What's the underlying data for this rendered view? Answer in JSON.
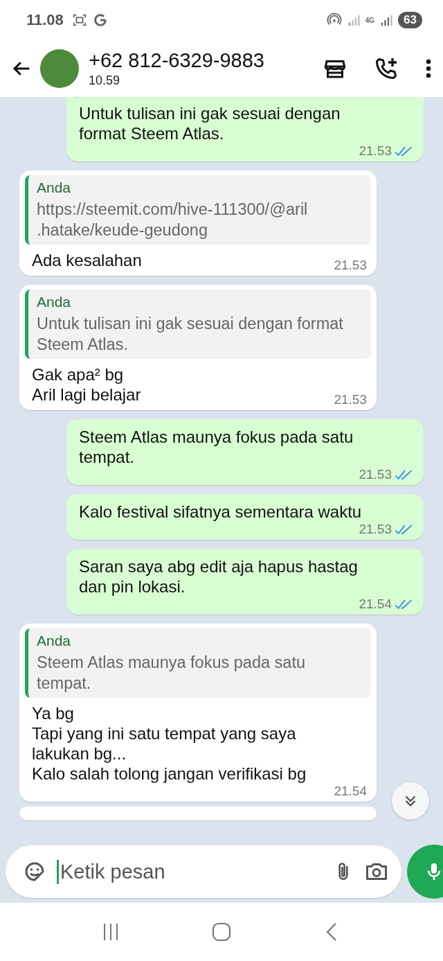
{
  "status_bar": {
    "time": "11.08",
    "network": "4G",
    "battery": "63"
  },
  "header": {
    "contact": "+62 812-6329-9883",
    "last_seen": "10.59"
  },
  "messages": [
    {
      "kind": "out",
      "quote_cut": true,
      "text": "Untuk tulisan ini gak sesuai dengan format Steem Atlas.",
      "time": "21.53",
      "read": true
    },
    {
      "kind": "in",
      "quote": {
        "author": "Anda",
        "text": "https://steemit.com/hive-111300/@aril .hatake/keude-geudong"
      },
      "text": "Ada kesalahan",
      "time": "21.53"
    },
    {
      "kind": "in",
      "quote": {
        "author": "Anda",
        "text": "Untuk tulisan ini gak sesuai dengan format Steem Atlas."
      },
      "text": "Gak apa² bg\nAril lagi belajar",
      "time": "21.53"
    },
    {
      "kind": "out",
      "text": "Steem Atlas maunya fokus pada satu tempat.",
      "time": "21.53",
      "read": true
    },
    {
      "kind": "out",
      "text": "Kalo festival sifatnya sementara waktu",
      "time": "21.53",
      "read": true
    },
    {
      "kind": "out",
      "text": "Saran saya abg edit aja hapus hastag dan pin lokasi.",
      "time": "21.54",
      "read": true
    },
    {
      "kind": "in",
      "quote": {
        "author": "Anda",
        "text": "Steem Atlas maunya fokus pada satu tempat."
      },
      "text": "Ya bg\nTapi yang ini satu tempat yang saya lakukan bg...\nKalo salah tolong jangan verifikasi bg",
      "time": "21.54"
    }
  ],
  "composer": {
    "placeholder": "Ketik pesan"
  }
}
